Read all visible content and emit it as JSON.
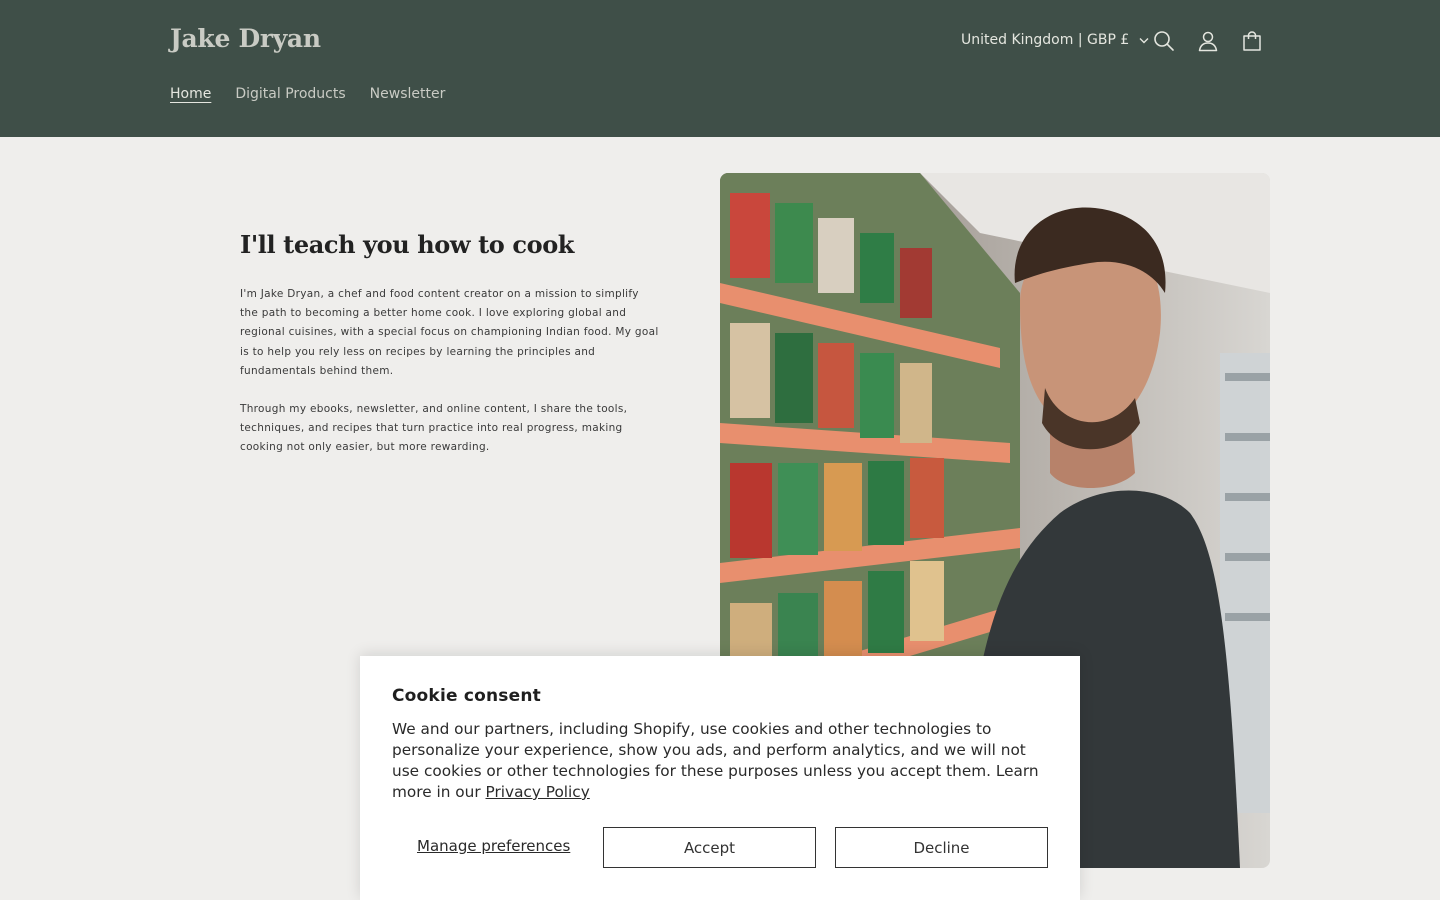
{
  "header": {
    "brand": "Jake Dryan",
    "country_selector": "United Kingdom | GBP £",
    "icons": [
      "search-icon",
      "account-icon",
      "cart-icon"
    ],
    "nav": [
      {
        "label": "Home",
        "active": true
      },
      {
        "label": "Digital Products",
        "active": false
      },
      {
        "label": "Newsletter",
        "active": false
      }
    ]
  },
  "hero": {
    "title": "I'll teach you how to cook",
    "paragraph_1": "I'm Jake Dryan, a chef and food content creator on a mission to simplify the path to becoming a better home cook. I love exploring global and regional cuisines, with a special focus on championing Indian food. My goal is to help you rely less on recipes by learning the principles and fundamentals behind them.",
    "paragraph_2": "Through my ebooks, newsletter, and online content, I share the tools, techniques, and recipes that turn practice into real progress, making cooking not only easier, but more rewarding."
  },
  "cookie": {
    "title": "Cookie consent",
    "text": "We and our partners, including Shopify, use cookies and other technologies to personalize your experience, show you ads, and perform analytics, and we will not use cookies or other technologies for these purposes unless you accept them. Learn more in our",
    "link": "Privacy Policy",
    "manage_label": "Manage preferences",
    "accept_label": "Accept",
    "decline_label": "Decline"
  },
  "colors": {
    "header_bg": "#3f4f48",
    "page_bg": "#efeeec",
    "brand_text": "#c9cbc4"
  }
}
